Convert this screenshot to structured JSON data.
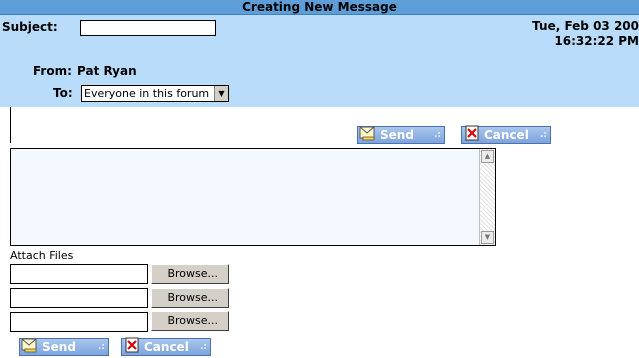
{
  "window": {
    "title": "Creating New Message"
  },
  "header": {
    "subject_label": "Subject:",
    "subject_value": "",
    "from_label": "From:",
    "from_value": "Pat Ryan",
    "to_label": "To:",
    "to_value": "Everyone in this forum",
    "date_line1": "Tue, Feb 03 200",
    "date_line2": "16:32:22 PM"
  },
  "actions": {
    "send_label": "Send",
    "cancel_label": "Cancel"
  },
  "message": {
    "body": ""
  },
  "attachments": {
    "label": "Attach Files",
    "browse_label": "Browse...",
    "rows": [
      {
        "value": ""
      },
      {
        "value": ""
      },
      {
        "value": ""
      }
    ]
  },
  "colors": {
    "title_bar": "#5d9ed8",
    "header_bg": "#b9dcfb",
    "button_bg": "#8eb2e6",
    "textarea_bg": "#f4f9ff"
  }
}
